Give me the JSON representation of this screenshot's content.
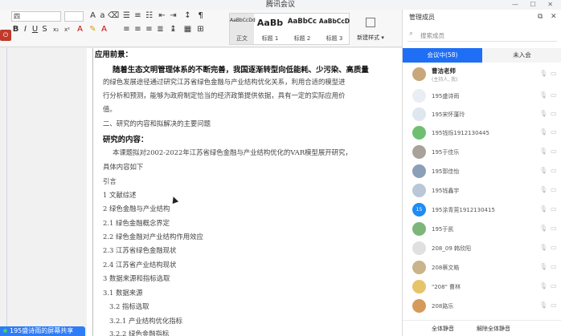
{
  "window": {
    "title": "腾讯会议"
  },
  "ribbon": {
    "font_name": "四",
    "font_size": "",
    "styles": [
      {
        "sample": "AaBbCcDd",
        "name": "正文"
      },
      {
        "sample": "AaBb",
        "name": "标题 1"
      },
      {
        "sample": "AaBbCc",
        "name": "标题 2"
      },
      {
        "sample": "AaBbCcD",
        "name": "标题 3"
      }
    ],
    "new_style_label": "新建样式 ▾"
  },
  "document": {
    "lines": [
      {
        "text": "应用前景：",
        "style": "bold"
      },
      {
        "text": "随着生态文明管理体系的不断完善，我国逐渐转型向低能耗、少污染、高质量",
        "style": "bold"
      },
      {
        "text": "的绿色发展途径通过研究江苏省绿色金融与产业结构优化关系，利用合适的模型进",
        "style": "sm"
      },
      {
        "text": "行分析和预测，能够为政府制定恰当的经济政策提供依据，具有一定的实际应用价",
        "style": "sm"
      },
      {
        "text": "值。",
        "style": "sm"
      },
      {
        "text": "二、研究的内容和拟解决的主要问题",
        "style": "sm"
      },
      {
        "text": "研究的内容：",
        "style": "bold"
      },
      {
        "text": "本课题拟对2002-2022年江苏省绿色金融与产业结构优化的VAR模型展开研究，",
        "style": "sm"
      },
      {
        "text": "具体内容如下",
        "style": "sm"
      },
      {
        "text": "引言",
        "style": "sm"
      },
      {
        "text": "1 文献综述",
        "style": "sm"
      },
      {
        "text": "2 绿色金融与产业结构",
        "style": "sm"
      },
      {
        "text": "2.1 绿色金融概念界定",
        "style": "sm"
      },
      {
        "text": "2.2 绿色金融对产业结构作用效应",
        "style": "sm"
      },
      {
        "text": "2.3 江苏省绿色金融现状",
        "style": "sm"
      },
      {
        "text": "2.4 江苏省产业结构现状",
        "style": "sm"
      },
      {
        "text": "3 数据来源和指标选取",
        "style": "sm"
      },
      {
        "text": "3.1 数据来源",
        "style": "sm"
      },
      {
        "text": "3.2 指标选取",
        "style": "sm"
      },
      {
        "text": "3.2.1 产业结构优化指标",
        "style": "sm"
      },
      {
        "text": "3.2.2 绿色金融指标",
        "style": "sm"
      }
    ]
  },
  "share_banner": {
    "text": "195盛诗雨的屏幕共享"
  },
  "panel": {
    "title": "管理成员",
    "search_placeholder": "搜索成员",
    "tab_in_meeting": "会议中(58)",
    "tab_not_joined": "未入会",
    "members": [
      {
        "name": "曹洁老师",
        "sub": "(主持人, 我)",
        "avatar": "#c8a77a",
        "host": true
      },
      {
        "name": "195盛诗雨",
        "avatar": "#e8eef3"
      },
      {
        "name": "195宋怀蓬玲",
        "avatar": "#dfe7ee"
      },
      {
        "name": "195钱烁19121304​45",
        "avatar": "#6fbf73"
      },
      {
        "name": "195于佳乐",
        "avatar": "#a9a29a"
      },
      {
        "name": "195郭佳怡",
        "avatar": "#8aa0b8"
      },
      {
        "name": "195钱鑫宇",
        "avatar": "#b9c7d6"
      },
      {
        "name": "195涂青莞1912130415",
        "avatar": "#1e8cf5",
        "initial": "15"
      },
      {
        "name": "195于凯",
        "avatar": "#7db67a"
      },
      {
        "name": "208_09 韩欣阳",
        "avatar": "#e0e0e0"
      },
      {
        "name": "208蔡文皓",
        "avatar": "#c9b48b"
      },
      {
        "name": "\"208\" 曹林",
        "avatar": "#e7c36a"
      },
      {
        "name": "208路乐",
        "avatar": "#d69a5a"
      }
    ],
    "mute_all": "全体静音",
    "unmute_all": "解除全体静音"
  }
}
